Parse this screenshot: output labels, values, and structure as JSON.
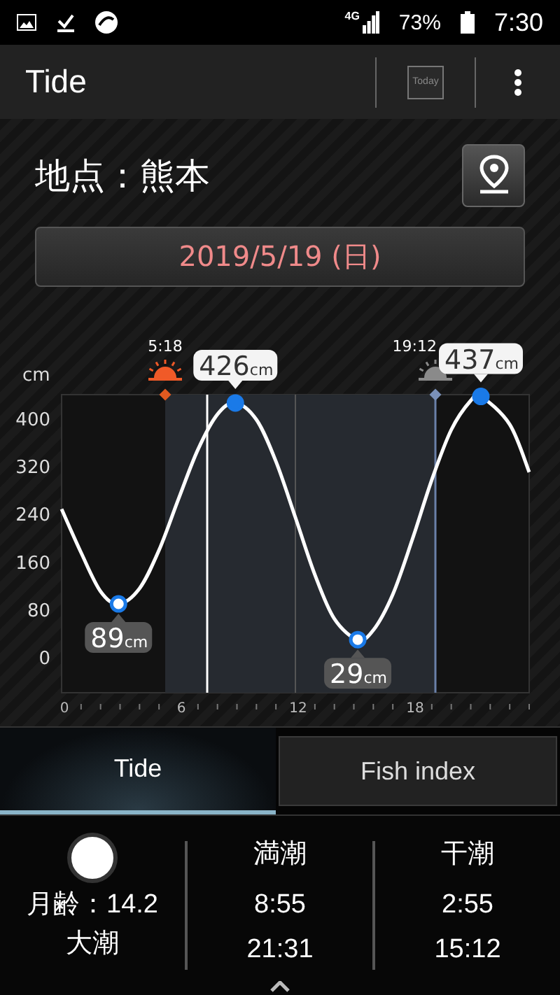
{
  "status_bar": {
    "network": "4G",
    "battery": "73%",
    "time": "7:30"
  },
  "app_bar": {
    "title": "Tide",
    "today_button": "Today"
  },
  "location": {
    "label": "地点：熊本"
  },
  "date_button": {
    "label": "2019/5/19 (日)"
  },
  "chart": {
    "sunrise_time": "5:18",
    "sunset_time": "19:12",
    "chart_data": {
      "type": "line",
      "ylabel": "cm",
      "x": [
        0,
        1,
        2,
        2.92,
        4,
        5,
        6,
        7,
        8,
        8.92,
        10,
        11,
        12,
        13,
        14,
        15.2,
        16,
        17,
        18,
        19,
        20,
        21,
        21.52,
        23,
        24
      ],
      "series": [
        {
          "color": "#ffffff",
          "values": [
            248,
            175,
            110,
            89,
            115,
            179,
            265,
            348,
            407,
            426,
            398,
            328,
            234,
            138,
            64,
            29,
            45,
            105,
            197,
            297,
            381,
            430,
            437,
            390,
            310
          ]
        }
      ],
      "xlim": [
        0,
        24
      ],
      "ylim": [
        -60,
        440
      ],
      "xticks": [
        0,
        6,
        12,
        18
      ],
      "yticks": [
        0,
        80,
        160,
        240,
        320,
        400
      ],
      "annotations": [
        {
          "x": 2.92,
          "y": 89,
          "text": "89cm"
        },
        {
          "x": 8.92,
          "y": 426,
          "text": "426cm"
        },
        {
          "x": 15.2,
          "y": 29,
          "text": "29cm"
        },
        {
          "x": 21.52,
          "y": 437,
          "text": "437cm"
        }
      ]
    }
  },
  "tabs": [
    {
      "label": "Tide",
      "selected": true
    },
    {
      "label": "Fish index",
      "selected": false
    }
  ],
  "moon": {
    "age": "月齢：14.2",
    "tide_type": "大潮"
  },
  "tide_times": [
    {
      "heading": "満潮",
      "times": [
        "8:55",
        "21:31"
      ]
    },
    {
      "heading": "干潮",
      "times": [
        "2:55",
        "15:12"
      ]
    }
  ]
}
